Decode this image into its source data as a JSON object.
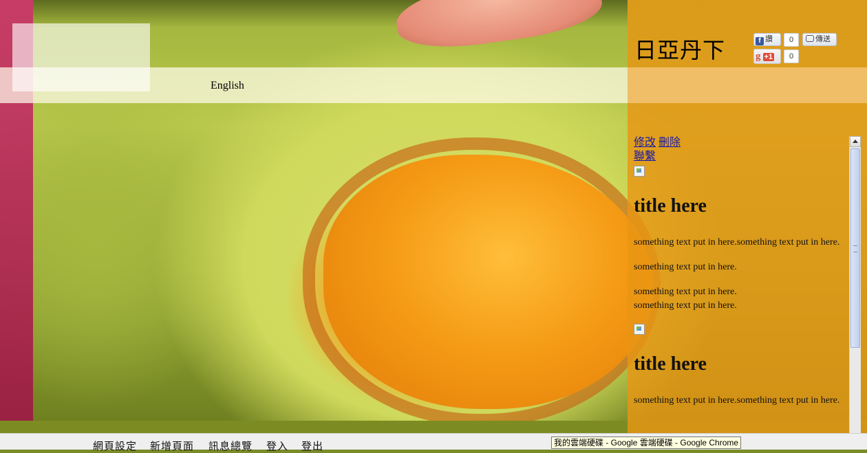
{
  "site": {
    "title": "日亞丹下",
    "language_link": "English"
  },
  "social": {
    "facebook_like_label": "讚",
    "facebook_like_count": "0",
    "share_label": "傳送",
    "gplus_label": "+1",
    "gplus_count": "0"
  },
  "admin_links": {
    "edit": "修改",
    "delete": "刪除",
    "contact": "聯繫"
  },
  "posts": [
    {
      "title": "title here",
      "paragraphs": [
        "something text put in here.something text put in here.",
        "something text put in here.",
        "something text put in here.\nsomething text put in here."
      ]
    },
    {
      "title": "title here",
      "paragraphs": [
        "something text put in here.something text put in here."
      ]
    }
  ],
  "bottom_menu": [
    "網頁設定",
    "新增頁面",
    "訊息總覽",
    "登入",
    "登出"
  ],
  "tooltip": "我的雲端硬碟 - Google 雲端硬碟 - Google Chrome",
  "colors": {
    "left_strip": "#c8286e",
    "right_panel": "#e8961e",
    "link": "#1a1aa8"
  }
}
